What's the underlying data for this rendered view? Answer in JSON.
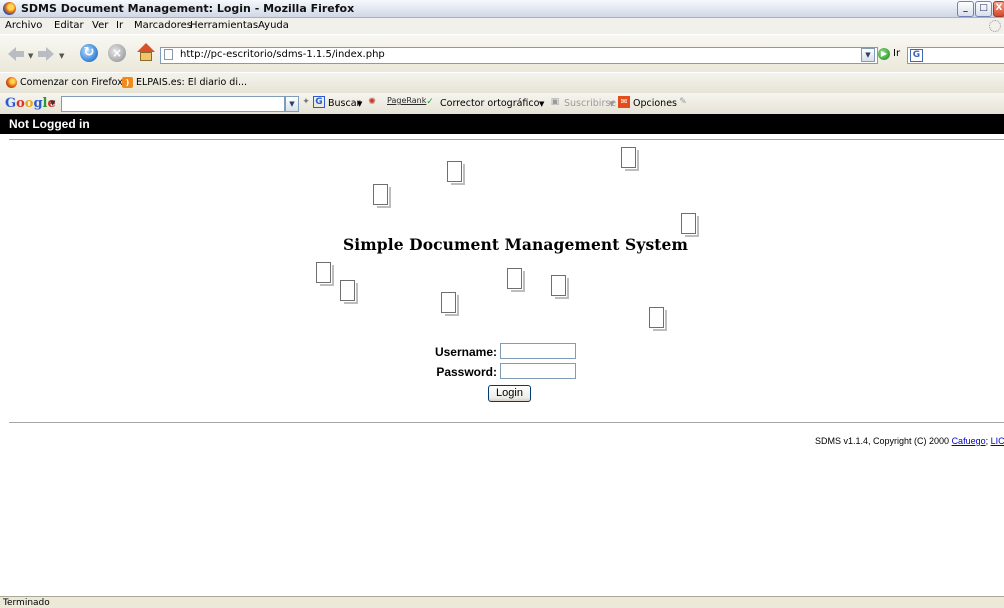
{
  "window": {
    "title": "SDMS Document Management: Login - Mozilla Firefox",
    "controls": [
      "_",
      "□",
      "X"
    ]
  },
  "menubar": {
    "items": [
      {
        "label": "Archivo"
      },
      {
        "label": "Editar"
      },
      {
        "label": "Ver"
      },
      {
        "label": "Ir"
      },
      {
        "label": "Marcadores"
      },
      {
        "label": "Herramientas"
      },
      {
        "label": "Ayuda"
      }
    ]
  },
  "navbar": {
    "url": "http://pc-escritorio/sdms-1.1.5/index.php",
    "go_label": "Ir",
    "icons": {
      "back": "back-arrow-icon",
      "forward": "forward-arrow-icon",
      "reload": "reload-icon",
      "stop": "stop-icon",
      "home": "home-icon"
    }
  },
  "bookmarks": {
    "items": [
      {
        "label": "Comenzar con Firefox",
        "icon": "firefox-icon"
      },
      {
        "label": "ELPAIS.es: El diario di...",
        "icon": "rss-icon"
      }
    ]
  },
  "google_toolbar": {
    "logo": "Google",
    "search_value": "",
    "buscar_label": "Buscar",
    "pagerank_label": "PageRank",
    "spell_label": "Corrector ortográfico",
    "subscribe_label": "Suscribirse",
    "options_label": "Opciones"
  },
  "page": {
    "login_status": "Not Logged in",
    "system_title": "Simple Document Management System",
    "form": {
      "username_label": "Username:",
      "password_label": "Password:",
      "username_value": "",
      "password_value": "",
      "login_button": "Login"
    },
    "footer": {
      "copyright_text": "SDMS v1.1.4, Copyright (C) 2000 ",
      "link1": "Cafuego",
      "separator": "; ",
      "link2": "LICENSE"
    }
  },
  "status_bar": {
    "text": "Terminado"
  },
  "colors": {
    "topbar_bg": "#000000",
    "link": "#0000cc",
    "chrome_bg": "#ece9d8"
  }
}
